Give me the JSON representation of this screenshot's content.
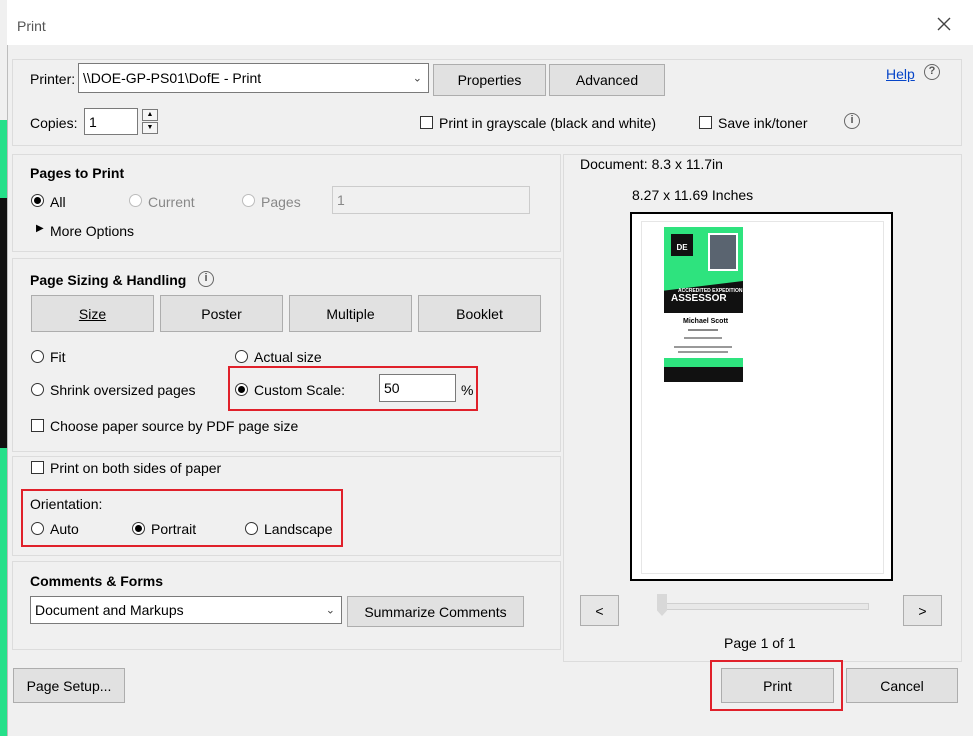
{
  "dialog": {
    "title": "Print"
  },
  "printer": {
    "label": "Printer:",
    "value": "\\\\DOE-GP-PS01\\DofE - Print",
    "properties_button": "Properties",
    "advanced_button": "Advanced",
    "help_link": "Help"
  },
  "copies": {
    "label": "Copies:",
    "value": "1",
    "grayscale_label": "Print in grayscale (black and white)",
    "save_ink_label": "Save ink/toner"
  },
  "pages_to_print": {
    "heading": "Pages to Print",
    "all": "All",
    "current": "Current",
    "pages": "Pages",
    "pages_value": "1",
    "more_options": "More Options"
  },
  "sizing": {
    "heading": "Page Sizing & Handling",
    "tabs": [
      "Size",
      "Poster",
      "Multiple",
      "Booklet"
    ],
    "fit": "Fit",
    "actual_size": "Actual size",
    "shrink": "Shrink oversized pages",
    "custom_scale": "Custom Scale:",
    "custom_scale_value": "50",
    "percent": "%",
    "paper_source": "Choose paper source by PDF page size"
  },
  "duplex": {
    "label": "Print on both sides of paper"
  },
  "orientation": {
    "label": "Orientation:",
    "auto": "Auto",
    "portrait": "Portrait",
    "landscape": "Landscape"
  },
  "comments": {
    "heading": "Comments & Forms",
    "value": "Document and Markups",
    "summarize_button": "Summarize Comments"
  },
  "preview": {
    "document_size": "Document: 8.3 x 11.7in",
    "page_size": "8.27 x 11.69 Inches",
    "prev": "<",
    "next": ">",
    "page_indicator": "Page 1 of 1",
    "card": {
      "logo": "DE",
      "subtitle": "ACCREDITED EXPEDITION",
      "title": "ASSESSOR",
      "name": "Michael Scott"
    }
  },
  "footer": {
    "page_setup": "Page Setup...",
    "print": "Print",
    "cancel": "Cancel"
  },
  "colors": {
    "highlight": "#e0202a",
    "card_green": "#2ee37e"
  }
}
